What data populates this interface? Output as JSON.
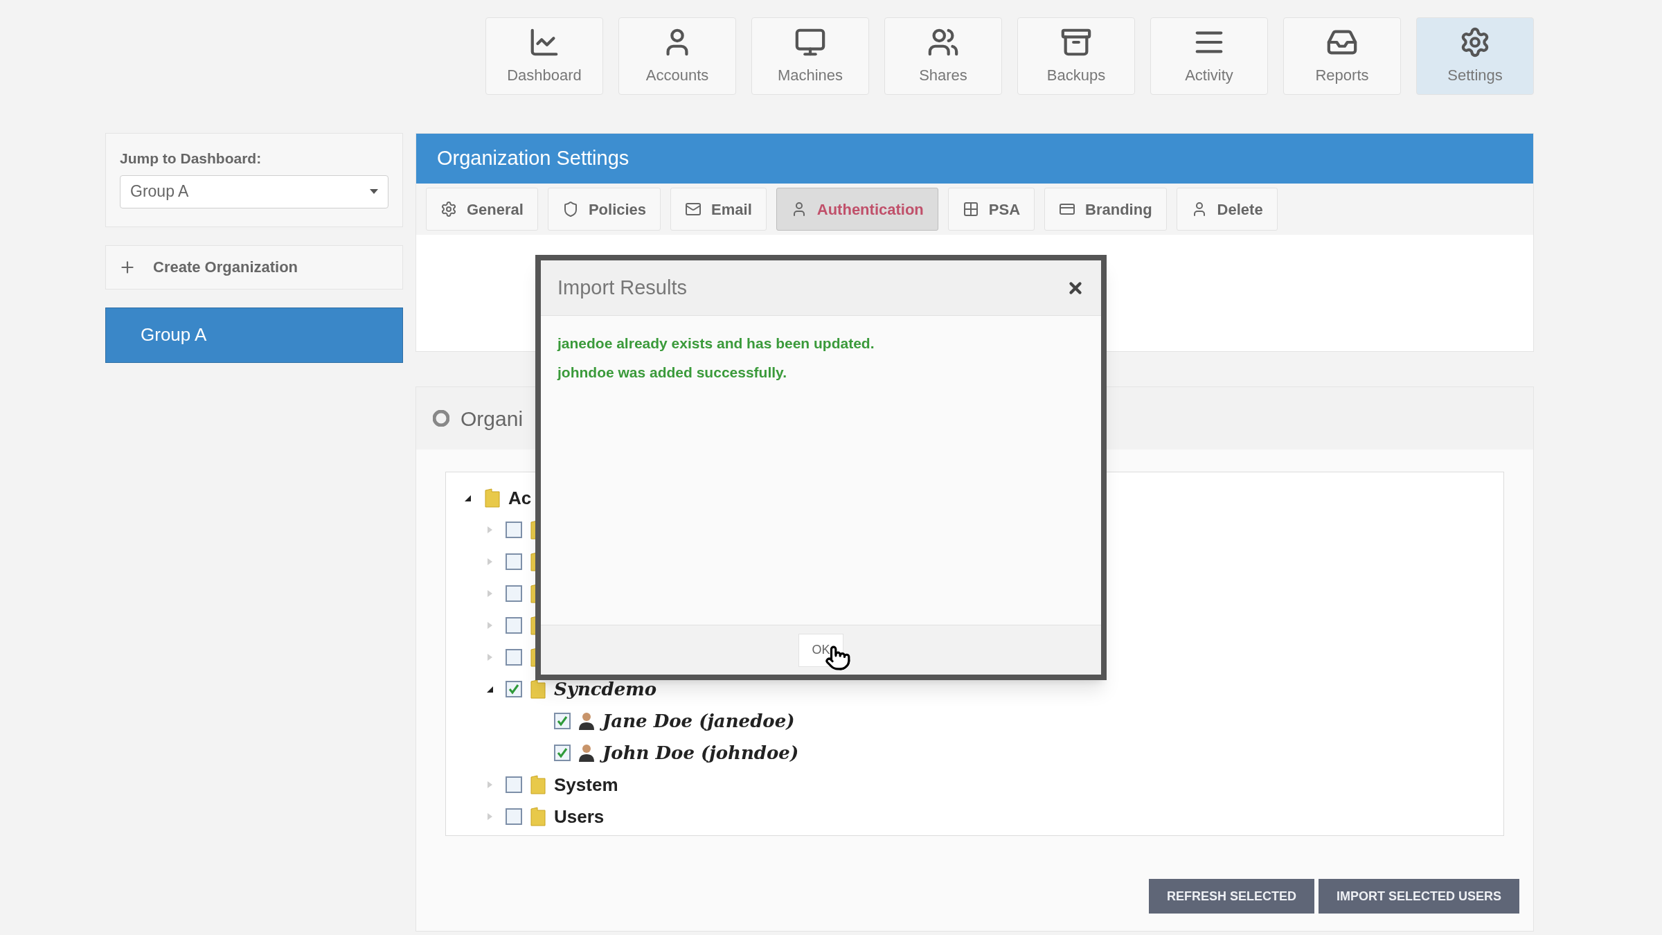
{
  "nav": [
    {
      "label": "Dashboard",
      "selected": false
    },
    {
      "label": "Accounts",
      "selected": false
    },
    {
      "label": "Machines",
      "selected": false
    },
    {
      "label": "Shares",
      "selected": false
    },
    {
      "label": "Backups",
      "selected": false
    },
    {
      "label": "Activity",
      "selected": false
    },
    {
      "label": "Reports",
      "selected": false
    },
    {
      "label": "Settings",
      "selected": true
    }
  ],
  "sidebar": {
    "jump_label": "Jump to Dashboard:",
    "jump_value": "Group A",
    "create_button": "Create Organization",
    "organizations": [
      {
        "label": "Group A",
        "selected": true
      }
    ]
  },
  "settings": {
    "title": "Organization Settings",
    "tabs": [
      {
        "label": "General",
        "selected": false
      },
      {
        "label": "Policies",
        "selected": false
      },
      {
        "label": "Email",
        "selected": false
      },
      {
        "label": "Authentication",
        "selected": true
      },
      {
        "label": "PSA",
        "selected": false
      },
      {
        "label": "Branding",
        "selected": false
      },
      {
        "label": "Delete",
        "selected": false
      }
    ]
  },
  "section": {
    "title": "Organi",
    "tree": [
      {
        "kind": "folder",
        "label": "Ac",
        "expanded": true,
        "children": [
          {
            "kind": "folder",
            "checked": false,
            "expanded": false
          },
          {
            "kind": "folder",
            "checked": false,
            "expanded": false
          },
          {
            "kind": "folder",
            "checked": false,
            "expanded": false
          },
          {
            "kind": "folder",
            "checked": false,
            "expanded": false
          },
          {
            "kind": "folder",
            "checked": false,
            "expanded": false
          },
          {
            "kind": "folder",
            "label": "Syncdemo",
            "checked": true,
            "expanded": true,
            "children": [
              {
                "kind": "user",
                "label": "Jane Doe (janedoe)",
                "checked": true
              },
              {
                "kind": "user",
                "label": "John Doe (johndoe)",
                "checked": true
              }
            ]
          },
          {
            "kind": "folder",
            "label": "System",
            "checked": false,
            "expanded": false
          },
          {
            "kind": "folder",
            "label": "Users",
            "checked": false,
            "expanded": false
          }
        ]
      }
    ],
    "buttons": [
      "REFRESH SELECTED",
      "IMPORT SELECTED USERS"
    ]
  },
  "dialog": {
    "title": "Import Results",
    "messages": [
      "janedoe already exists and has been updated.",
      "johndoe was added successfully."
    ],
    "ok_button": "OK"
  }
}
